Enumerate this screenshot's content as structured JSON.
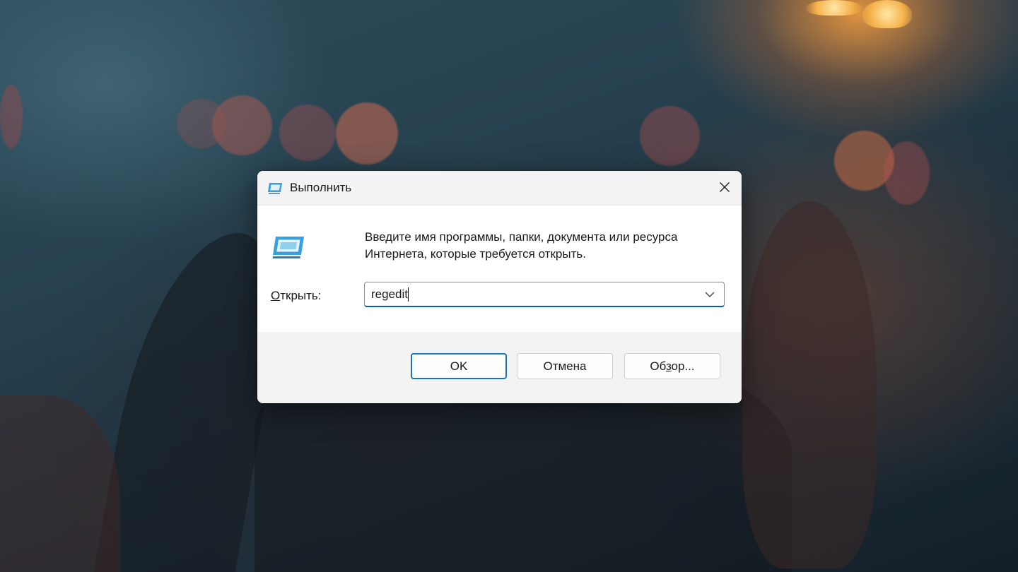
{
  "desktop": {
    "wallpaper": "cat-bokeh-night"
  },
  "run_dialog": {
    "title": "Выполнить",
    "close_icon": "close-icon",
    "app_icon": "run-icon",
    "description": "Введите имя программы, папки, документа или ресурса Интернета, которые требуется открыть.",
    "open_label_accel": "О",
    "open_label_rest": "ткрыть:",
    "input_value": "regedit",
    "dropdown_icon": "chevron-down-icon",
    "buttons": {
      "ok": "OK",
      "cancel": "Отмена",
      "browse_pre": "Об",
      "browse_accel": "з",
      "browse_post": "ор..."
    },
    "colors": {
      "accent": "#005fb8",
      "icon_blue": "#3aa0dc"
    }
  }
}
